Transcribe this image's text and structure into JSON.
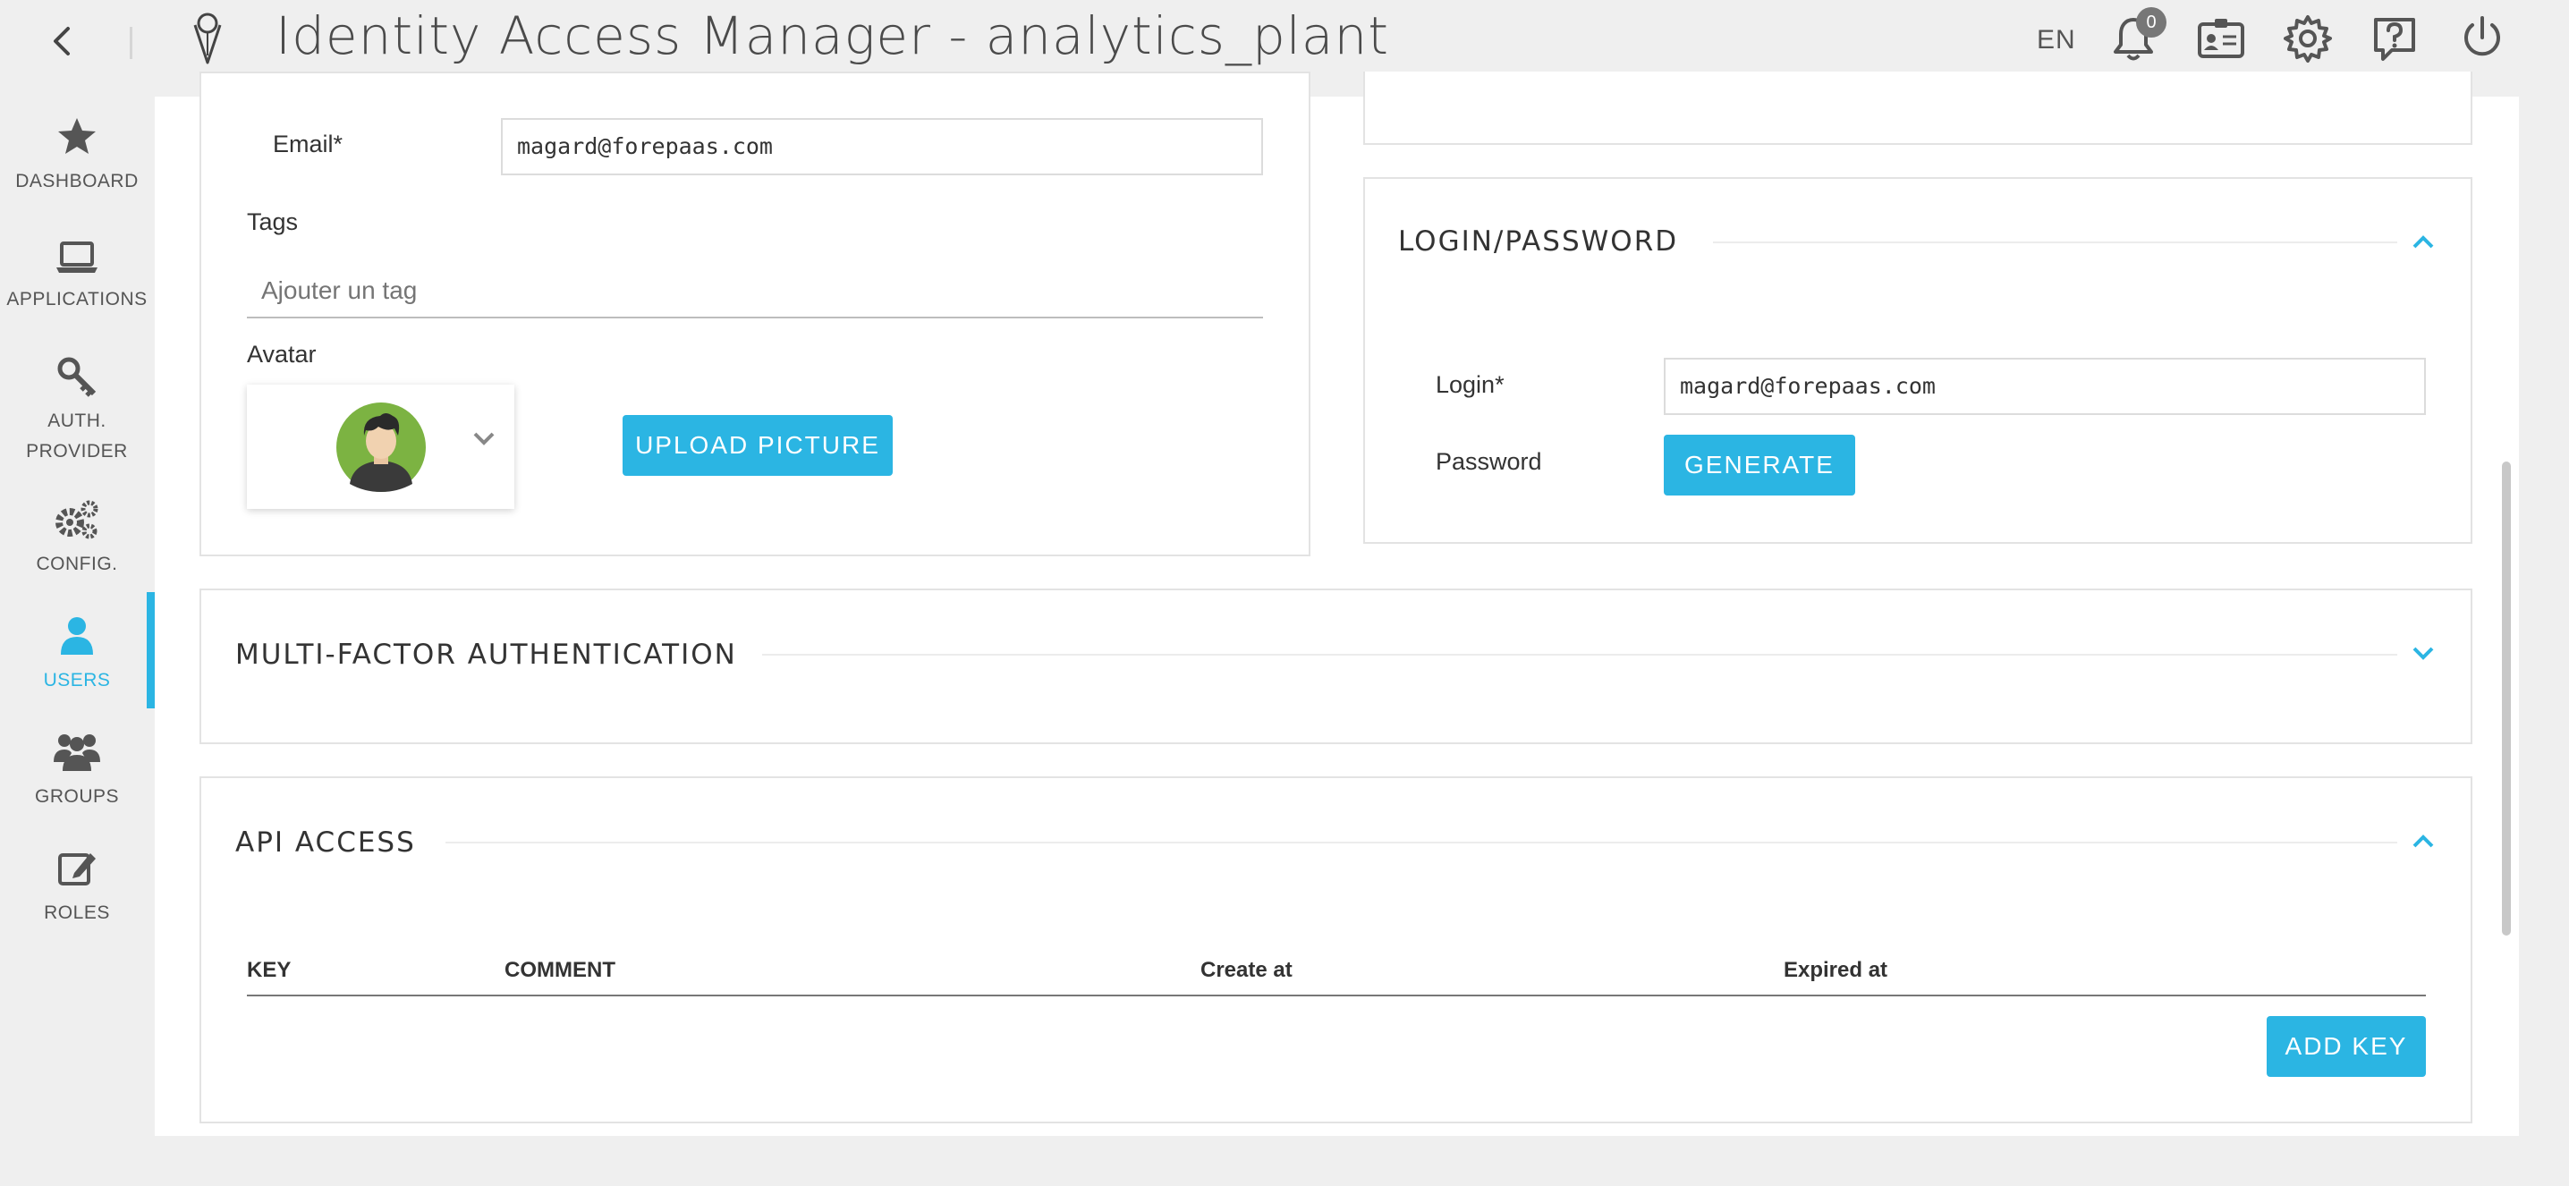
{
  "app": {
    "title": "Identity Access Manager - analytics_plant",
    "language": "EN",
    "notifications_count": "0"
  },
  "topbar": {
    "icons": [
      "back-icon",
      "logo-icon",
      "bell-icon",
      "id-card-icon",
      "gear-icon",
      "help-icon",
      "power-icon"
    ]
  },
  "nav": {
    "items": [
      {
        "label": "DASHBOARD",
        "icon": "star-icon"
      },
      {
        "label": "APPLICATIONS",
        "icon": "laptop-icon"
      },
      {
        "label_line1": "AUTH.",
        "label_line2": "PROVIDER",
        "icon": "key-icon"
      },
      {
        "label": "CONFIG.",
        "icon": "gears-icon"
      },
      {
        "label": "USERS",
        "icon": "user-icon",
        "active": true
      },
      {
        "label": "GROUPS",
        "icon": "group-icon"
      },
      {
        "label": "ROLES",
        "icon": "edit-icon"
      }
    ]
  },
  "profile": {
    "email_label": "Email*",
    "email_value": "magard@forepaas.com",
    "tags_label": "Tags",
    "tags_placeholder": "Ajouter un tag",
    "avatar_label": "Avatar",
    "upload_button": "UPLOAD PICTURE"
  },
  "login_password": {
    "title": "LOGIN/PASSWORD",
    "login_label": "Login*",
    "login_value": "magard@forepaas.com",
    "password_label": "Password",
    "generate_button": "GENERATE"
  },
  "mfa": {
    "title": "MULTI-FACTOR AUTHENTICATION"
  },
  "api_access": {
    "title": "API ACCESS",
    "columns": [
      "KEY",
      "COMMENT",
      "Create at",
      "Expired at"
    ],
    "add_button": "ADD KEY"
  },
  "colors": {
    "accent": "#2bb5e3",
    "background": "#efefef",
    "panel": "#ffffff"
  }
}
